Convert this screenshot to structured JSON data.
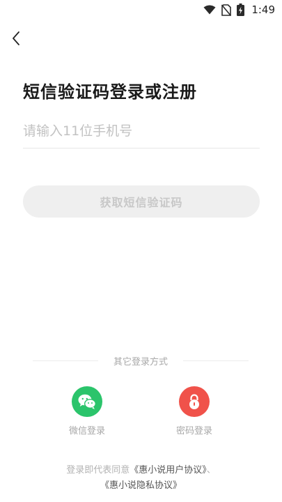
{
  "status_bar": {
    "time": "1:49",
    "icons": [
      "wifi-icon",
      "no-sim-icon",
      "battery-charging-icon"
    ]
  },
  "header": {
    "back_icon": "chevron-left-icon"
  },
  "title": "短信验证码登录或注册",
  "phone_input": {
    "placeholder": "请输入11位手机号",
    "value": ""
  },
  "get_code_button": {
    "label": "获取短信验证码",
    "enabled": false
  },
  "other_login": {
    "divider_text": "其它登录方式",
    "options": [
      {
        "label": "微信登录",
        "icon": "wechat-icon",
        "color": "#2bc46b"
      },
      {
        "label": "密码登录",
        "icon": "lock-icon",
        "color": "#f0524a"
      }
    ]
  },
  "agreement": {
    "prefix": "登录即代表同意",
    "user_agreement": "《惠小说用户协议》",
    "separator": "、",
    "privacy_agreement": "《惠小说隐私协议》"
  },
  "colors": {
    "wechat_green": "#2bc46b",
    "password_red": "#f0524a",
    "disabled_button_bg": "#efefef",
    "disabled_button_text": "#c8c8c8"
  }
}
